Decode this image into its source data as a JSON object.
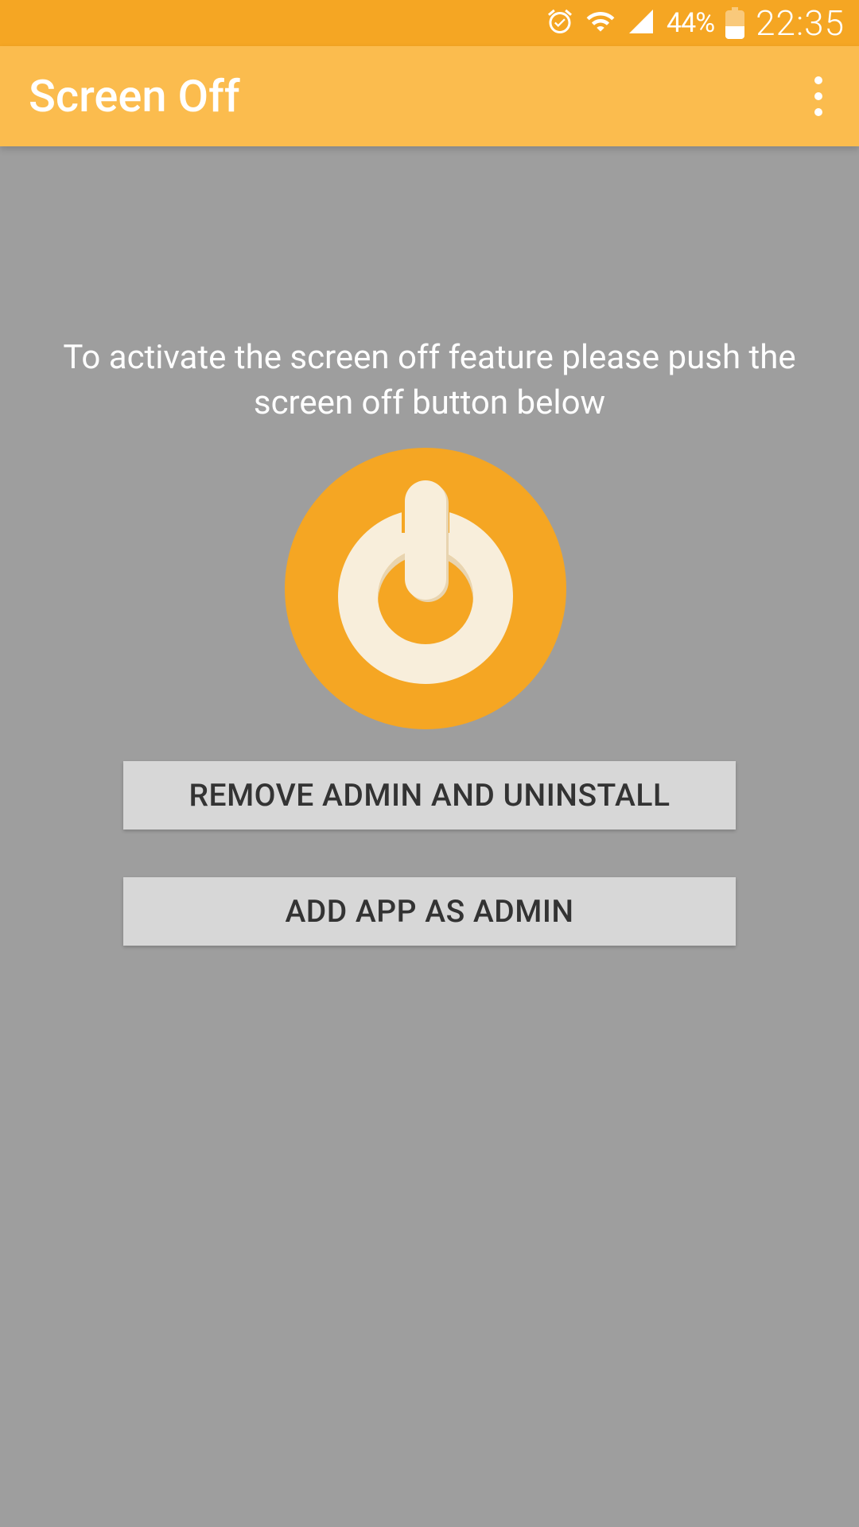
{
  "statusBar": {
    "batteryPercent": "44%",
    "time": "22:35"
  },
  "appBar": {
    "title": "Screen Off"
  },
  "main": {
    "instruction": "To activate the screen off feature please push the screen off button below",
    "removeAdminLabel": "REMOVE ADMIN AND UNINSTALL",
    "addAdminLabel": "ADD APP AS ADMIN"
  }
}
